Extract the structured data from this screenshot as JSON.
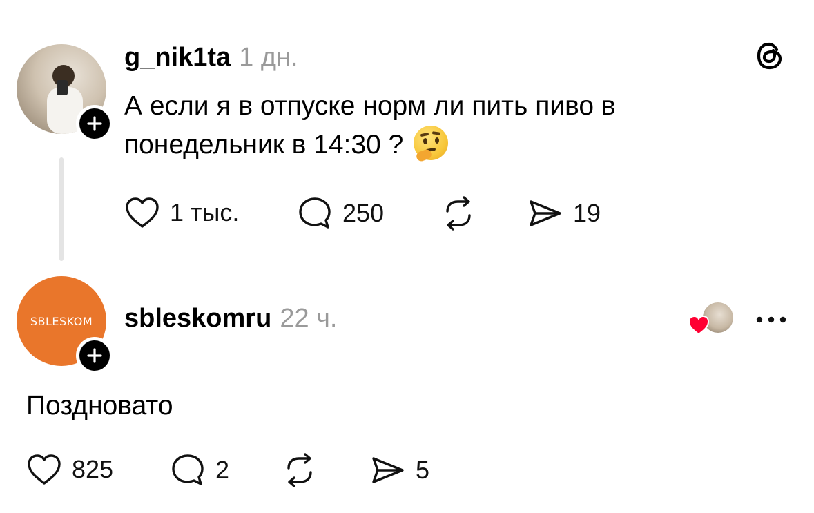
{
  "post": {
    "username": "g_nik1ta",
    "time": "1 дн.",
    "text_line1": "А если я в отпуске норм ли пить пиво в",
    "text_line2": "понедельник в 14:30 ?",
    "emoji": "thinking-face",
    "actions": {
      "likes": "1 тыс.",
      "comments": "250",
      "reposts": "",
      "shares": "19"
    }
  },
  "reply": {
    "username": "sbleskomru",
    "time": "22 ч.",
    "avatar_brand": "SBLESKOM",
    "text": "Поздновато",
    "actions": {
      "likes": "825",
      "comments": "2",
      "reposts": "",
      "shares": "5"
    }
  },
  "colors": {
    "brand_orange": "#e9762b",
    "heart_red": "#ff0033",
    "muted_text": "#9a9a9a",
    "thread_line": "#e4e4e4"
  },
  "icons": [
    "threads-logo-icon",
    "plus-icon",
    "heart-icon",
    "comment-icon",
    "repost-icon",
    "share-icon",
    "more-icon"
  ]
}
